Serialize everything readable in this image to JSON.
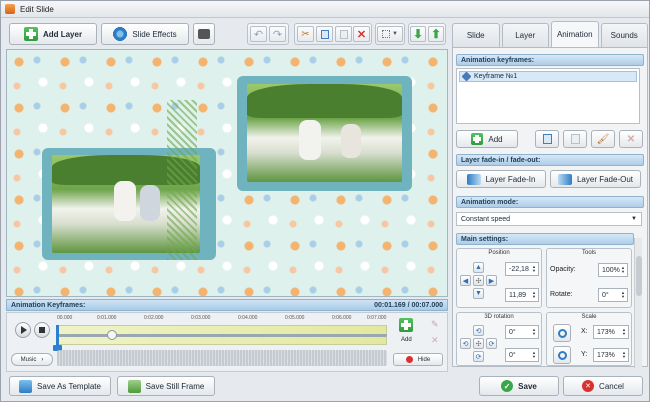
{
  "window": {
    "title": "Edit Slide"
  },
  "toolbar": {
    "add_layer": "Add Layer",
    "slide_effects": "Slide Effects"
  },
  "colors": {
    "accent_green": "#3aa64a",
    "accent_blue": "#2f7fd1",
    "section_header": "#aecde8",
    "delete_red": "#d93030"
  },
  "timeline": {
    "header": "Animation Keyframes:",
    "time": "00:01.169 / 00:07.000",
    "ruler": [
      "00.000",
      "0:01.000",
      "0:02.000",
      "0:03.000",
      "0:04.000",
      "0:05.000",
      "0:06.000",
      "0:07.000"
    ],
    "position_fraction": 0.167,
    "music_label": "Music",
    "add_label": "Add",
    "hide_label": "Hide"
  },
  "tabs": [
    {
      "label": "Slide",
      "active": false
    },
    {
      "label": "Layer",
      "active": false
    },
    {
      "label": "Animation",
      "active": true
    },
    {
      "label": "Sounds",
      "active": false
    }
  ],
  "animation": {
    "keyframes_header": "Animation keyframes:",
    "keyframe_item": "Keyframe №1",
    "add_label": "Add",
    "fade_header": "Layer fade-in / fade-out:",
    "fade_in": "Layer Fade-In",
    "fade_out": "Layer Fade-Out",
    "mode_header": "Animation mode:",
    "mode_value": "Constant speed",
    "main_header": "Main settings:",
    "position_label": "Position",
    "tools_label": "Tools",
    "pos_x": "-22,18",
    "pos_y": "11,89",
    "opacity_label": "Opacity:",
    "opacity_value": "100%",
    "rotate_label": "Rotate:",
    "rotate_value": "0°",
    "rotation3d_label": "3D rotation",
    "scale_label": "Scale",
    "rot_x": "0°",
    "rot_y": "0°",
    "scale_x_label": "X:",
    "scale_x": "173%",
    "scale_y_label": "Y:",
    "scale_y": "173%"
  },
  "footer": {
    "save_template": "Save As Template",
    "save_frame": "Save Still Frame",
    "save": "Save",
    "cancel": "Cancel"
  }
}
